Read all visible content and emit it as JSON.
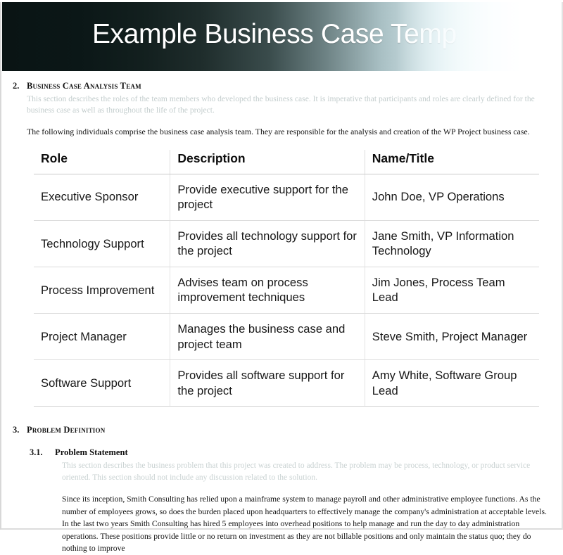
{
  "banner": {
    "title": "Example Business Case Temp"
  },
  "section2": {
    "number": "2.",
    "heading": "Business Case Analysis Team",
    "hint": "This section describes the roles of the team members who developed the business case.  It is imperative that participants and roles are clearly defined for the business case as well as throughout the life of the project.",
    "paragraph": "The following individuals comprise the business case analysis team.  They are responsible for the analysis and creation of the WP Project business case."
  },
  "team_table": {
    "columns": [
      "Role",
      "Description",
      "Name/Title"
    ],
    "rows": [
      {
        "role": "Executive Sponsor",
        "description": "Provide executive support for the project",
        "name_title": "John Doe, VP Operations"
      },
      {
        "role": "Technology Support",
        "description": "Provides all technology support for the project",
        "name_title": "Jane Smith, VP Information Technology"
      },
      {
        "role": "Process Improvement",
        "description": "Advises team on process improvement techniques",
        "name_title": "Jim Jones, Process Team Lead"
      },
      {
        "role": "Project Manager",
        "description": "Manages the business case and project team",
        "name_title": "Steve Smith, Project Manager"
      },
      {
        "role": "Software Support",
        "description": "Provides all software support for the project",
        "name_title": "Amy White, Software Group Lead"
      }
    ]
  },
  "section3": {
    "number": "3.",
    "heading": "Problem Definition",
    "subsection": {
      "number": "3.1.",
      "heading": "Problem Statement",
      "hint": "This section describes the business problem that this project was created to address.  The problem may be process, technology, or product service oriented.  This section should not include any discussion related to the solution.",
      "paragraph": "Since its inception, Smith Consulting has relied upon a mainframe system to manage payroll and other administrative employee functions.  As the number of employees grows, so does the burden placed upon headquarters to effectively manage the company's administration at acceptable levels.  In the last two years Smith Consulting has hired 5 employees into overhead positions to help manage and run the day to day administration operations.  These positions provide little or no return on investment as they are not billable positions and only maintain the status quo; they do nothing to improve"
    }
  },
  "colors": {
    "banner_dark": "#0a1414",
    "banner_light": "#ffffff",
    "hint_text": "#c3cdcd",
    "body_text": "#141414",
    "table_rule": "#dcdcdc"
  }
}
